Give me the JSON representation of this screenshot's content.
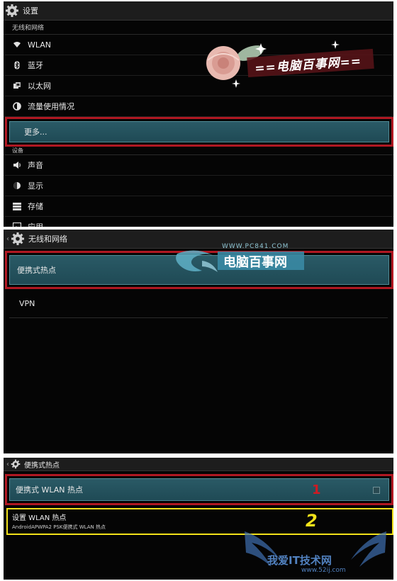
{
  "panel1": {
    "title": "设置",
    "section_wireless": "无线和网络",
    "items_wireless": [
      {
        "label": "WLAN",
        "icon": "wifi-icon"
      },
      {
        "label": "蓝牙",
        "icon": "bluetooth-icon"
      },
      {
        "label": "以太网",
        "icon": "ethernet-icon"
      },
      {
        "label": "流量使用情况",
        "icon": "data-usage-icon"
      }
    ],
    "more_label": "更多...",
    "section_device": "设备",
    "items_device": [
      {
        "label": "声音",
        "icon": "sound-icon"
      },
      {
        "label": "显示",
        "icon": "display-icon"
      },
      {
        "label": "存储",
        "icon": "storage-icon"
      },
      {
        "label": "应用",
        "icon": "apps-icon"
      }
    ],
    "watermark_text": "==电脑百事网=="
  },
  "panel2": {
    "title": "无线和网络",
    "hotspot_label": "便携式热点",
    "vpn_label": "VPN",
    "watermark_site": "WWW.PC841.COM",
    "watermark_name": "电脑百事网"
  },
  "panel3": {
    "title": "便携式热点",
    "portable_wlan_label": "便携式 WLAN 热点",
    "setup_title": "设置 WLAN 热点",
    "setup_subtitle": "AndroidAPWPA2 PSK便携式 WLAN 热点",
    "marker_1": "1",
    "marker_2": "2",
    "watermark_name": "我爱IT技术网",
    "watermark_site": "www.52ij.com"
  },
  "colors": {
    "highlight_red": "#b01822",
    "highlight_yellow": "#f2e21a",
    "teal_bg": "#24525d"
  }
}
